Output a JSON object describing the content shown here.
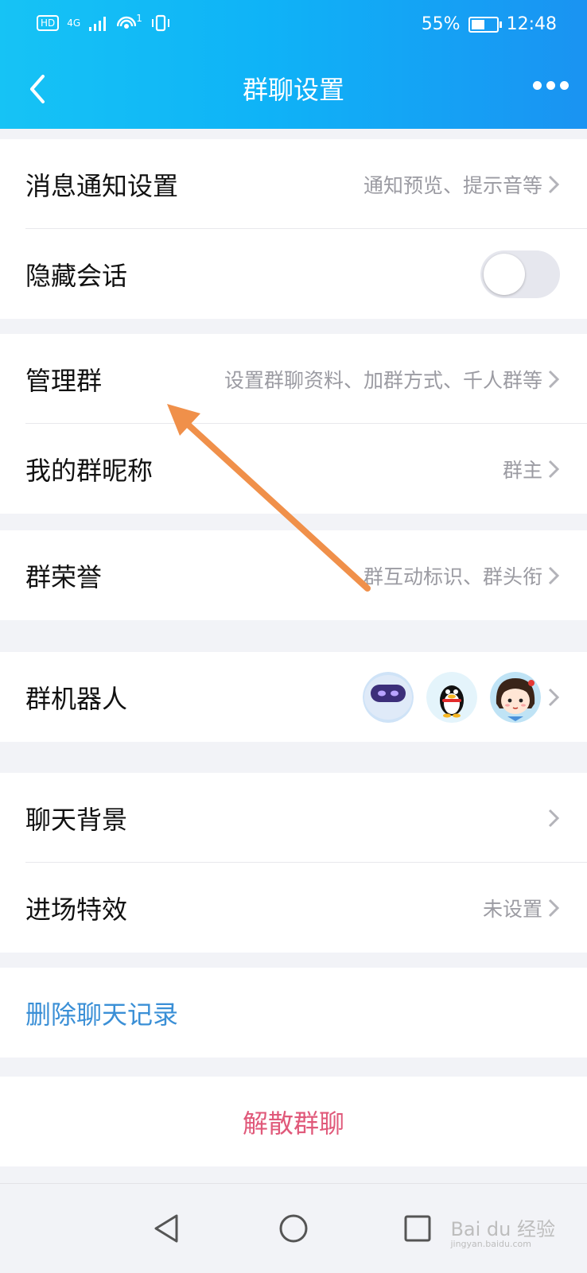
{
  "status_bar": {
    "hd_badge": "HD",
    "network": "4G",
    "sim_slot": "1",
    "battery_percent": "55%",
    "battery_level": 0.55,
    "time": "12:48"
  },
  "header": {
    "title": "群聊设置"
  },
  "sections": {
    "notify": {
      "label": "消息通知设置",
      "value": "通知预览、提示音等"
    },
    "hide_chat": {
      "label": "隐藏会话",
      "toggle_on": false
    },
    "manage": {
      "label": "管理群",
      "value": "设置群聊资料、加群方式、千人群等"
    },
    "nickname": {
      "label": "我的群昵称",
      "value": "群主"
    },
    "honor": {
      "label": "群荣誉",
      "value": "群互动标识、群头衔"
    },
    "robot": {
      "label": "群机器人",
      "avatars": [
        "robot-avatar",
        "penguin-avatar",
        "girl-avatar"
      ]
    },
    "background": {
      "label": "聊天背景"
    },
    "entry_effect": {
      "label": "进场特效",
      "value": "未设置"
    },
    "delete_history": {
      "label": "删除聊天记录",
      "color": "#3a8fd6"
    },
    "dissolve": {
      "label": "解散群聊",
      "color": "#e0597a"
    }
  },
  "watermark": {
    "brand": "Bai du 经验",
    "url": "jingyan.baidu.com"
  },
  "colors": {
    "header_start": "#16c3f5",
    "header_end": "#1a93f2",
    "annotation_arrow": "#f0904a"
  }
}
